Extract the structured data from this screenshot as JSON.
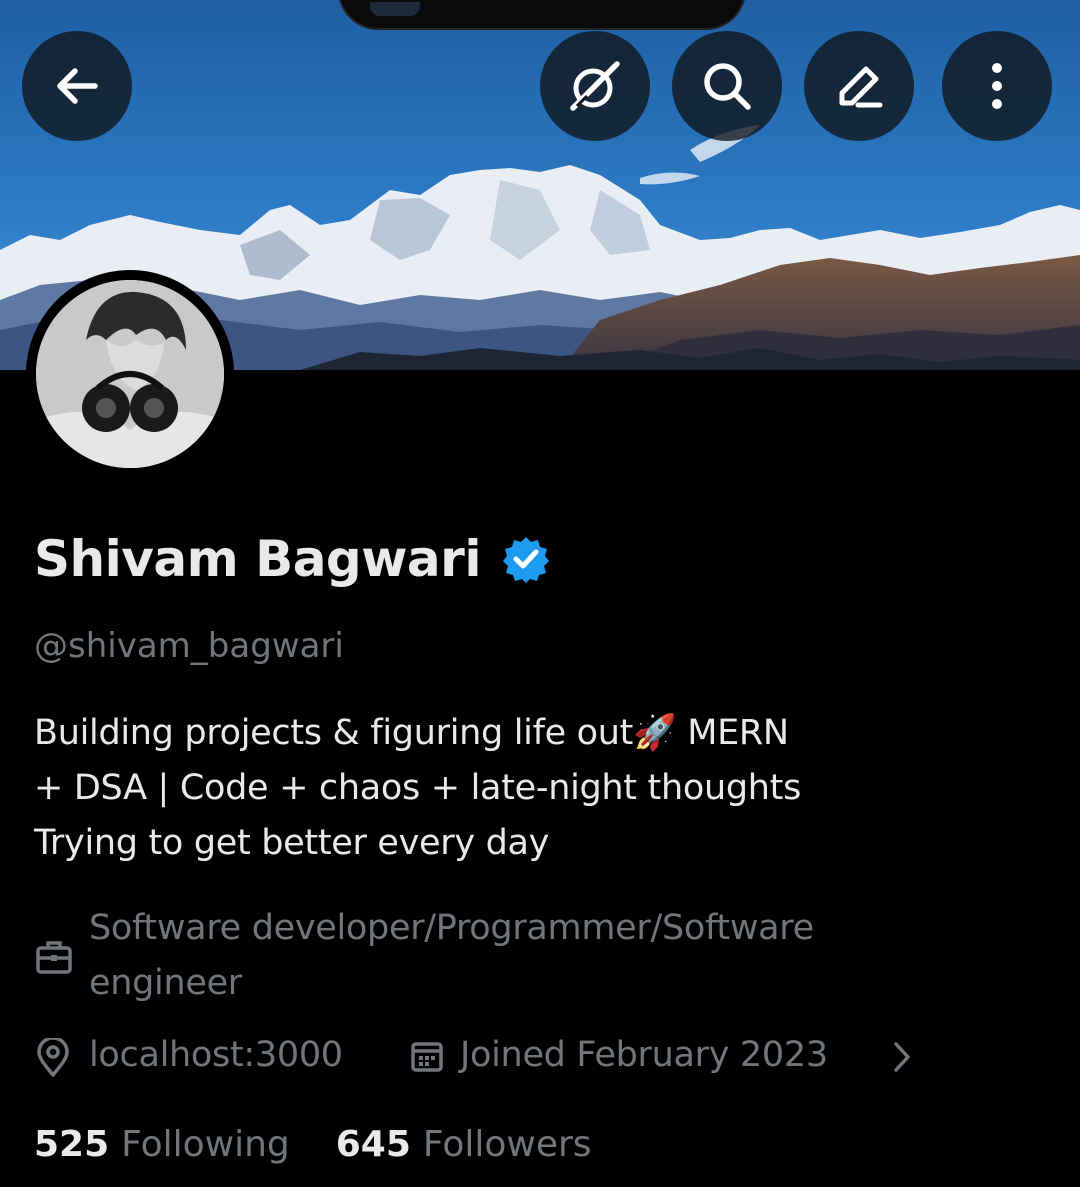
{
  "profile": {
    "name": "Shivam Bagwari",
    "handle": "@shivam_bagwari",
    "verified": true,
    "bio_lines": [
      "Building projects & figuring life out🚀  MERN",
      "+ DSA | Code + chaos + late-night thoughts",
      "Trying to get better every day"
    ],
    "profession": [
      "Software developer/Programmer/Software",
      "engineer"
    ],
    "location": "localhost:3000",
    "joined": "Joined February 2023",
    "following_count": "525",
    "following_label": "Following",
    "followers_count": "645",
    "followers_label": "Followers"
  },
  "header": {
    "buttons": [
      "back-arrow-icon",
      "grok-icon",
      "search-icon",
      "edit-icon",
      "more-vertical-icon"
    ]
  },
  "colors": {
    "background": "#000000",
    "primary_text": "#e7e9ea",
    "secondary_text": "#71767b",
    "verified_badge": "#1d9bf0",
    "button_bg": "rgba(15,20,25,0.78)"
  }
}
